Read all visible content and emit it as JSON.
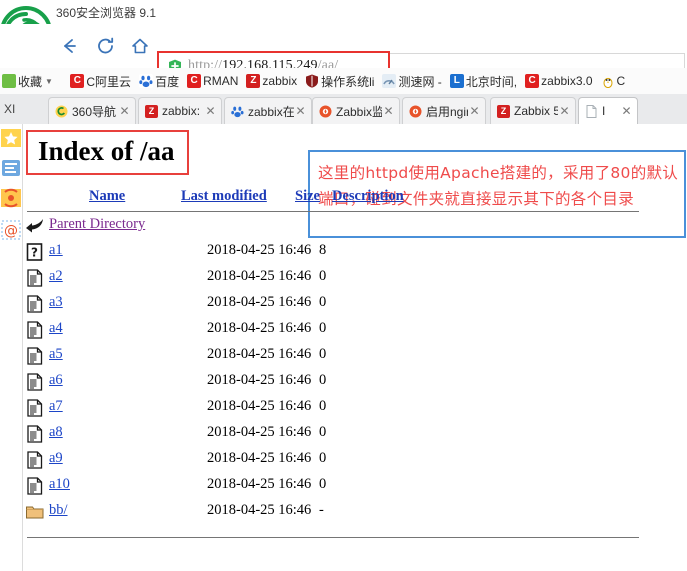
{
  "browser": {
    "app_title": "360安全浏览器 9.1",
    "logo_name": "360-browser-logo",
    "nav": {
      "back_label": "←",
      "reload_label": "⟳",
      "home_label": "⌂"
    },
    "address_bar": {
      "shield_icon": "security-shield-icon",
      "url_scheme": "http://",
      "url_host": "192.168.115.249",
      "url_path": "/aa/",
      "full_url": "http://192.168.115.249/aa/",
      "highlight_color": "#e8332f"
    },
    "bookmarks": {
      "favorites_label": "收藏",
      "favorites_icon": "star-folder-icon",
      "caret_icon": "chevron-down-icon",
      "items": [
        {
          "label": "C阿里云",
          "icon": "c-icon",
          "icon_class": "ico-c",
          "glyph": "C"
        },
        {
          "label": "百度",
          "icon": "baidu-paw-icon",
          "icon_class": "ico-baidu",
          "glyph": ""
        },
        {
          "label": "RMAN",
          "icon": "c-icon",
          "icon_class": "ico-c",
          "glyph": "C"
        },
        {
          "label": "zabbix",
          "icon": "z-icon",
          "icon_class": "ico-z",
          "glyph": "Z"
        },
        {
          "label": "操作系统li",
          "icon": "shield-icon",
          "icon_class": "ico-shield",
          "glyph": ""
        },
        {
          "label": "测速网 -",
          "icon": "speedtest-icon",
          "icon_class": "ico-speed",
          "glyph": ""
        },
        {
          "label": "北京时间,",
          "icon": "l-icon",
          "icon_class": "ico-l",
          "glyph": "L"
        },
        {
          "label": "zabbix3.0",
          "icon": "c-icon",
          "icon_class": "ico-c",
          "glyph": "C"
        },
        {
          "label": "C",
          "icon": "linux-penguin-icon",
          "icon_class": "ico-linux",
          "glyph": ""
        }
      ]
    },
    "tabs": {
      "strip_left_label": "XI",
      "items": [
        {
          "label": "360导航",
          "icon": "nav360-icon",
          "icon_class": "ico-nav360",
          "glyph": "",
          "close_icon": "close-icon",
          "active": false
        },
        {
          "label": "zabbix:",
          "icon": "z-icon",
          "icon_class": "ico-z",
          "glyph": "Z",
          "close_icon": "close-icon",
          "active": false
        },
        {
          "label": "zabbix在",
          "icon": "baidu-paw-icon",
          "icon_class": "ico-baidu",
          "glyph": "",
          "close_icon": "close-icon",
          "active": false
        },
        {
          "label": "Zabbix监",
          "icon": "firefox-icon",
          "icon_class": "ico-ff",
          "glyph": "",
          "close_icon": "close-icon",
          "active": false
        },
        {
          "label": "启用ngin",
          "icon": "firefox-icon",
          "icon_class": "ico-ff",
          "glyph": "",
          "close_icon": "close-icon",
          "active": false
        },
        {
          "label": "Zabbix 5",
          "icon": "z-icon",
          "icon_class": "ico-z",
          "glyph": "Z",
          "close_icon": "close-icon",
          "active": false
        },
        {
          "label": "I",
          "icon": "page-icon",
          "icon_class": "ico-page",
          "glyph": "",
          "close_icon": "close-icon",
          "active": true
        }
      ]
    },
    "side_rail": [
      {
        "name": "favorites-star-icon"
      },
      {
        "name": "notes-icon"
      },
      {
        "name": "broadcast-icon"
      },
      {
        "name": "mail-at-icon"
      }
    ]
  },
  "page": {
    "title": "Index of /aa",
    "annotation": "这里的httpd使用Apache搭建的，采用了80的默认端口，碰到文件夹就直接显示其下的各个目录",
    "annotation_border_color": "#4a90d9",
    "annotation_text_color": "#ef4b4b",
    "title_border_color": "#e8403c",
    "headers": {
      "name": "Name",
      "last_modified": "Last modified",
      "size": "Size",
      "description": "Description"
    },
    "parent_directory": {
      "label": "Parent Directory",
      "icon": "parent-directory-arrow-icon"
    },
    "rows": [
      {
        "name": "a1",
        "modified": "2018-04-25 16:46",
        "size": "8",
        "description": "",
        "icon": "unknown-file-icon",
        "type": "unknown"
      },
      {
        "name": "a2",
        "modified": "2018-04-25 16:46",
        "size": "0",
        "description": "",
        "icon": "text-file-icon",
        "type": "file"
      },
      {
        "name": "a3",
        "modified": "2018-04-25 16:46",
        "size": "0",
        "description": "",
        "icon": "text-file-icon",
        "type": "file"
      },
      {
        "name": "a4",
        "modified": "2018-04-25 16:46",
        "size": "0",
        "description": "",
        "icon": "text-file-icon",
        "type": "file"
      },
      {
        "name": "a5",
        "modified": "2018-04-25 16:46",
        "size": "0",
        "description": "",
        "icon": "text-file-icon",
        "type": "file"
      },
      {
        "name": "a6",
        "modified": "2018-04-25 16:46",
        "size": "0",
        "description": "",
        "icon": "text-file-icon",
        "type": "file"
      },
      {
        "name": "a7",
        "modified": "2018-04-25 16:46",
        "size": "0",
        "description": "",
        "icon": "text-file-icon",
        "type": "file"
      },
      {
        "name": "a8",
        "modified": "2018-04-25 16:46",
        "size": "0",
        "description": "",
        "icon": "text-file-icon",
        "type": "file"
      },
      {
        "name": "a9",
        "modified": "2018-04-25 16:46",
        "size": "0",
        "description": "",
        "icon": "text-file-icon",
        "type": "file"
      },
      {
        "name": "a10",
        "modified": "2018-04-25 16:46",
        "size": "0",
        "description": "",
        "icon": "text-file-icon",
        "type": "file"
      },
      {
        "name": "bb/",
        "modified": "2018-04-25 16:46",
        "size": "-",
        "description": "",
        "icon": "folder-icon",
        "type": "dir"
      }
    ]
  }
}
